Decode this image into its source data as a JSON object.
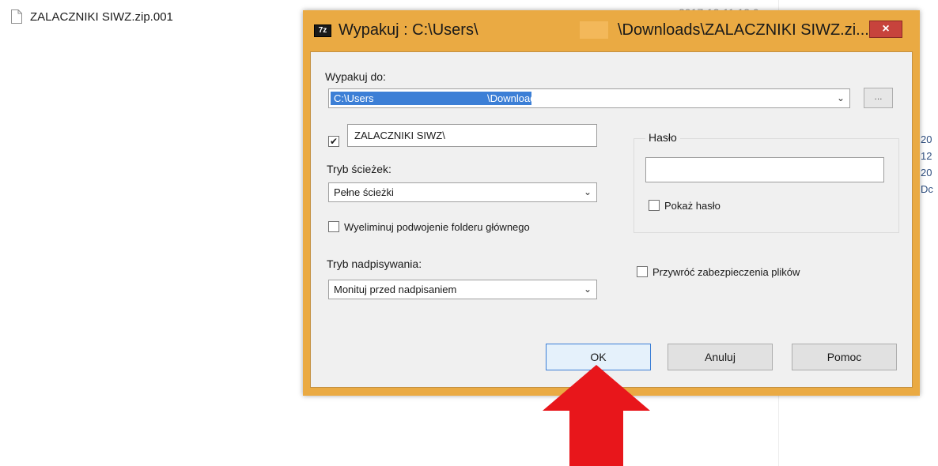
{
  "background": {
    "file_name": "ZALACZNIKI SIWZ.zip.001",
    "date_top": "2017-12-11 13:0",
    "right_column": [
      "20",
      "12",
      "20",
      "Dc"
    ]
  },
  "dialog": {
    "title_left": "Wypakuj : C:\\Users\\",
    "title_right": "\\Downloads\\ZALACZNIKI SIWZ.zi...",
    "app_icon": "7z",
    "close": "×",
    "extract_to_label": "Wypakuj do:",
    "extract_to_seg1": "C:\\Users",
    "extract_to_seg2": "\\Downloads\\",
    "browse": "...",
    "subfolder_checked": true,
    "subfolder_value": "ZALACZNIKI SIWZ\\",
    "path_mode_label": "Tryb ścieżek:",
    "path_mode_value": "Pełne ścieżki",
    "eliminate_dup_label": "Wyeliminuj podwojenie folderu głównego",
    "overwrite_label": "Tryb nadpisywania:",
    "overwrite_value": "Monituj przed nadpisaniem",
    "password_group": "Hasło",
    "show_password_label": "Pokaż hasło",
    "restore_security_label": "Przywróć zabezpieczenia plików",
    "ok": "OK",
    "cancel": "Anuluj",
    "help": "Pomoc"
  },
  "colors": {
    "titlebar": "#eaaa43",
    "close": "#c7433c",
    "selection": "#3c7fd6",
    "arrow": "#e8161b"
  }
}
